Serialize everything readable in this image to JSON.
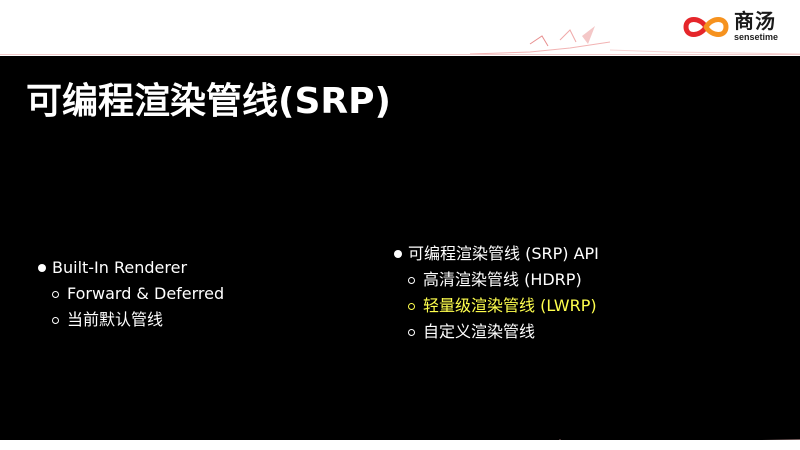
{
  "logo": {
    "cn": "商汤",
    "en": "sensetime",
    "colors": {
      "red": "#e5262b",
      "orange": "#f6921e"
    }
  },
  "title": "可编程渲染管线(SRP)",
  "left_list": {
    "heading": "Built-In Renderer",
    "items": [
      "Forward & Deferred",
      "当前默认管线"
    ]
  },
  "right_list": {
    "heading": "可编程渲染管线 (SRP) API",
    "items": [
      {
        "label": "高清渲染管线 (HDRP)",
        "highlight": false
      },
      {
        "label": "轻量级渲染管线 (LWRP)",
        "highlight": true,
        "color": "#ffff4d"
      },
      {
        "label": "自定义渲染管线",
        "highlight": false
      }
    ]
  }
}
